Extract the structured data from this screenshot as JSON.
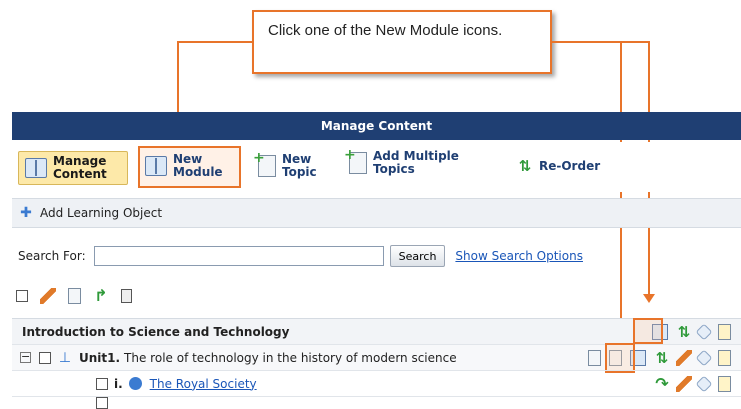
{
  "callout": {
    "text": "Click one of the New Module icons."
  },
  "header": {
    "title": "Manage Content"
  },
  "toolbar": {
    "manage": "Manage Content",
    "new_module": "New Module",
    "new_topic": "New Topic",
    "add_multiple": "Add Multiple Topics",
    "reorder": "Re-Order"
  },
  "add_learning_object": "Add Learning Object",
  "search": {
    "label": "Search For:",
    "value": "",
    "button": "Search",
    "options_link": "Show Search Options"
  },
  "rows": {
    "course_title": "Introduction to Science and Technology",
    "unit_prefix": "Unit1.",
    "unit_text": "The role of technology in the history of modern science",
    "item_prefix": "i.",
    "item_link": "The Royal Society"
  },
  "colors": {
    "header_bg": "#1f3f73",
    "accent": "#e8742a",
    "link": "#1a56b8"
  }
}
